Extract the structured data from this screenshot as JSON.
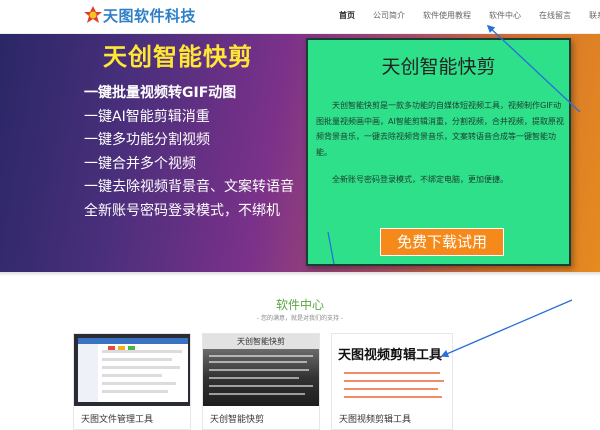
{
  "header": {
    "logo_text": "天图软件科技",
    "nav": [
      "首页",
      "公司简介",
      "软件使用教程",
      "软件中心",
      "在线留言",
      "联系我们"
    ]
  },
  "banner": {
    "title": "天创智能快剪",
    "features": [
      "一键批量视频转GIF动图",
      "一键AI智能剪辑消重",
      "一键多功能分割视频",
      "一键合并多个视频",
      "一键去除视频背景音、文案转语音",
      "全新账号密码登录模式，不绑机"
    ],
    "promo": {
      "title": "天创智能快剪",
      "description": "天创智能快剪是一款多功能的自媒体短视频工具，视频制作GIF动图批量视频画中画，AI智能剪辑消重，分割视频，合并视频，提取原视频背景音乐，一键去除视频背景音乐，文案转语音合成等一键智能功能。",
      "description2": "全新账号密码登录模式，不绑定电脑，更加便捷。",
      "button": "免费下载试用"
    }
  },
  "software_center": {
    "title": "软件中心",
    "subtitle": "- 您的满意，就是对我们的支持 -",
    "cards": [
      {
        "name": "天图文件管理工具"
      },
      {
        "name": "天创智能快剪",
        "thumb_title": "天创智能快剪"
      },
      {
        "name": "天图视频剪辑工具",
        "thumb_title": "天图视频剪辑工具"
      }
    ]
  },
  "colors": {
    "accent_blue": "#2f7fc8",
    "promo_green": "#2fe08a",
    "download_orange": "#f58a1a",
    "title_yellow": "#ffe733",
    "section_green": "#5aa545",
    "annotation_arrow": "#2a6fd8"
  }
}
